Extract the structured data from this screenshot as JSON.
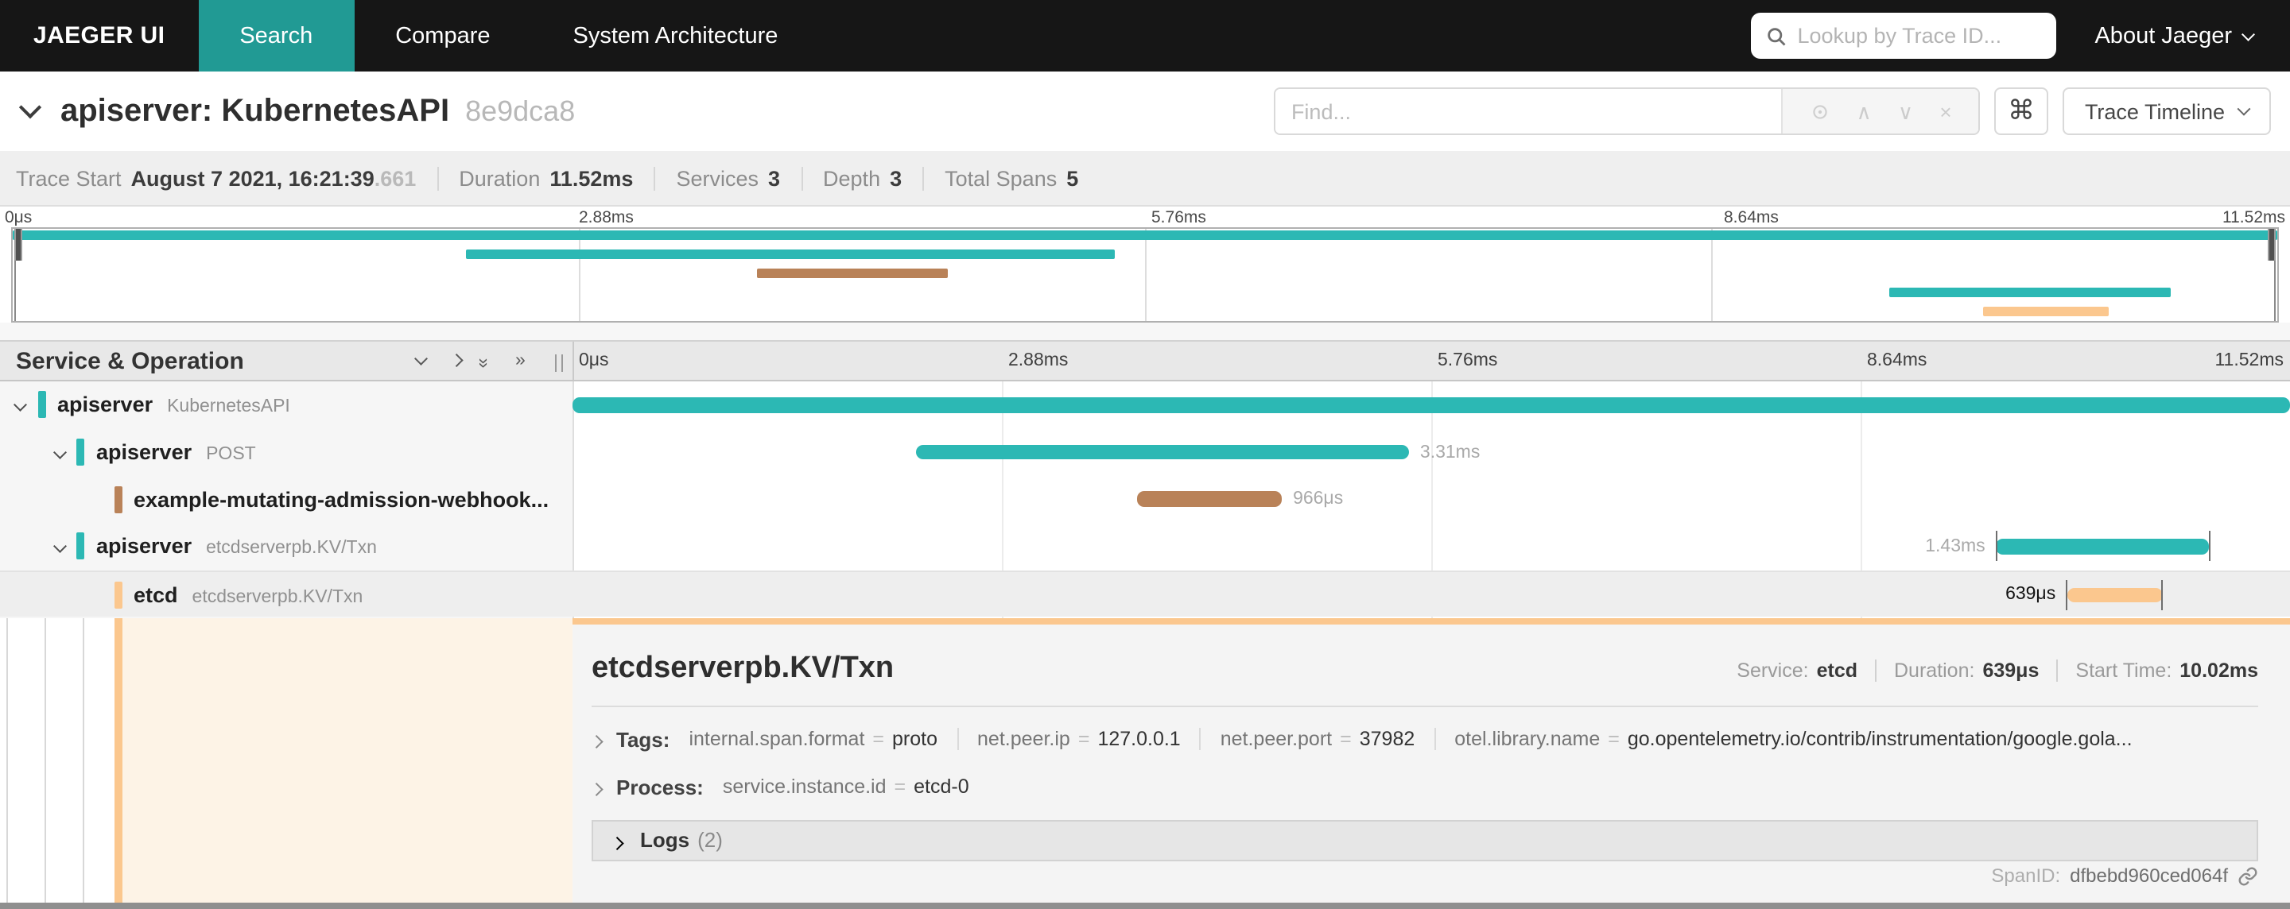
{
  "nav": {
    "brand": "JAEGER UI",
    "tabs": [
      "Search",
      "Compare",
      "System Architecture"
    ],
    "active_tab": "Search",
    "lookup_placeholder": "Lookup by Trace ID...",
    "about": "About Jaeger"
  },
  "trace": {
    "title": "apiserver: KubernetesAPI",
    "short_id": "8e9dca8",
    "find_placeholder": "Find...",
    "view_mode": "Trace Timeline"
  },
  "summary": {
    "trace_start_label": "Trace Start",
    "trace_start": "August 7 2021, 16:21:39",
    "trace_start_frac": ".661",
    "duration_label": "Duration",
    "duration": "11.52ms",
    "services_label": "Services",
    "services": "3",
    "depth_label": "Depth",
    "depth": "3",
    "total_spans_label": "Total Spans",
    "total_spans": "5"
  },
  "ticks": [
    "0μs",
    "2.88ms",
    "5.76ms",
    "8.64ms",
    "11.52ms"
  ],
  "left_header": {
    "title": "Service & Operation"
  },
  "colors": {
    "accent_teal": "#219a94",
    "span_teal": "#2cb8b4",
    "span_brown": "#b98258",
    "span_peach": "#fbc78e"
  },
  "spans": [
    {
      "service": "apiserver",
      "operation": "KubernetesAPI",
      "depth": 0,
      "has_children": true,
      "color": "#2cb8b4",
      "start_pct": 0,
      "width_pct": 100,
      "duration_label": "",
      "label_side": "none",
      "selected": false
    },
    {
      "service": "apiserver",
      "operation": "POST",
      "depth": 1,
      "has_children": true,
      "color": "#2cb8b4",
      "start_pct": 20,
      "width_pct": 28.7,
      "duration_label": "3.31ms",
      "label_side": "right",
      "selected": false
    },
    {
      "service": "example-mutating-admission-webhook...",
      "operation": "",
      "depth": 2,
      "has_children": false,
      "color": "#b98258",
      "start_pct": 32.9,
      "width_pct": 8.4,
      "duration_label": "966μs",
      "label_side": "right",
      "selected": false
    },
    {
      "service": "apiserver",
      "operation": "etcdserverpb.KV/Txn",
      "depth": 1,
      "has_children": true,
      "color": "#2cb8b4",
      "start_pct": 82.9,
      "width_pct": 12.4,
      "duration_label": "1.43ms",
      "label_side": "left",
      "selected": false,
      "end_ticks": true
    },
    {
      "service": "etcd",
      "operation": "etcdserverpb.KV/Txn",
      "depth": 2,
      "has_children": false,
      "color": "#fbc78e",
      "start_pct": 87,
      "width_pct": 5.55,
      "duration_label": "639μs",
      "label_side": "left",
      "selected": true,
      "end_ticks": true
    }
  ],
  "detail": {
    "title": "etcdserverpb.KV/Txn",
    "service_label": "Service:",
    "service": "etcd",
    "duration_label": "Duration:",
    "duration": "639μs",
    "start_label": "Start Time:",
    "start": "10.02ms",
    "tags_label": "Tags:",
    "tags": [
      {
        "key": "internal.span.format",
        "value": "proto"
      },
      {
        "key": "net.peer.ip",
        "value": "127.0.0.1"
      },
      {
        "key": "net.peer.port",
        "value": "37982"
      },
      {
        "key": "otel.library.name",
        "value": "go.opentelemetry.io/contrib/instrumentation/google.gola..."
      }
    ],
    "process_label": "Process:",
    "process": [
      {
        "key": "service.instance.id",
        "value": "etcd-0"
      }
    ],
    "logs_label": "Logs",
    "logs_count": "(2)",
    "span_id_label": "SpanID:",
    "span_id": "dfbebd960ced064f"
  }
}
